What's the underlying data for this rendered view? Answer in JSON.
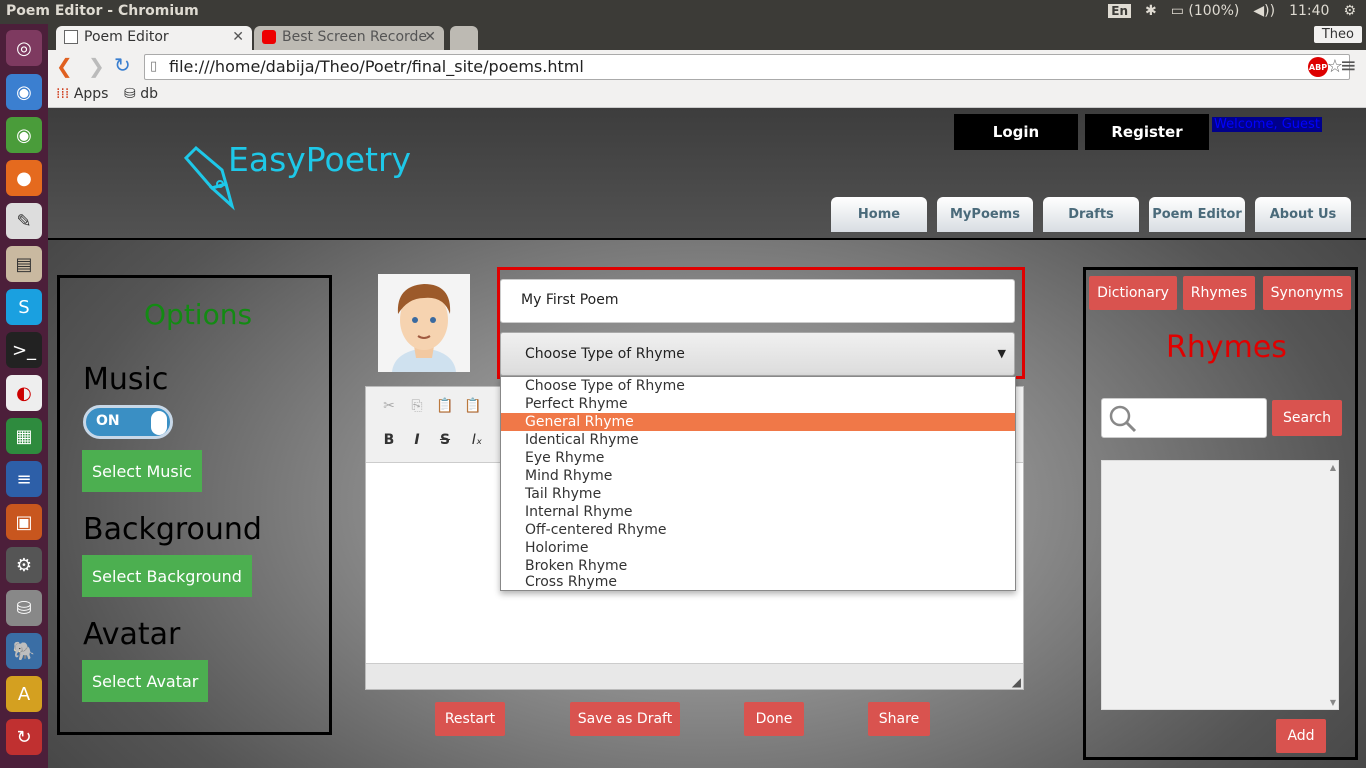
{
  "os": {
    "window_title": "Poem Editor - Chromium",
    "battery": "(100%)",
    "time": "11:40",
    "keyboard": "En",
    "launcher_items": [
      "ubuntu-dash",
      "chromium",
      "chrome",
      "firefox",
      "text-editor",
      "files",
      "skype",
      "terminal",
      "document-viewer",
      "spreadsheet",
      "writer",
      "impress",
      "system-settings",
      "database",
      "pgadmin",
      "app-store",
      "software-updater",
      "usb-drive"
    ]
  },
  "browser": {
    "tabs": [
      {
        "label": "Poem Editor",
        "active": true
      },
      {
        "label": "Best Screen Recorde",
        "active": false
      }
    ],
    "profile": "Theo",
    "url": "file:///home/dabija/Theo/Poetr/final_site/poems.html",
    "bookmarks": [
      {
        "label": "Apps"
      },
      {
        "label": "db"
      }
    ]
  },
  "site": {
    "logo": "EasyPoetry",
    "login_label": "Login",
    "register_label": "Register",
    "welcome": "Welcome, Guest",
    "nav": [
      {
        "label": "Home"
      },
      {
        "label": "MyPoems"
      },
      {
        "label": "Drafts"
      },
      {
        "label": "Poem Editor"
      },
      {
        "label": "About Us"
      }
    ]
  },
  "options": {
    "title": "Options",
    "music_heading": "Music",
    "toggle_state": "ON",
    "select_music": "Select Music",
    "background_heading": "Background",
    "select_background": "Select Background",
    "avatar_heading": "Avatar",
    "select_avatar": "Select Avatar"
  },
  "editor": {
    "title_value": "My First Poem",
    "rhyme_select_value": "Choose Type of Rhyme",
    "rhyme_options": [
      "Choose Type of Rhyme",
      "Perfect Rhyme",
      "General Rhyme",
      "Identical Rhyme",
      "Eye Rhyme",
      "Mind Rhyme",
      "Tail Rhyme",
      "Internal Rhyme",
      "Off-centered Rhyme",
      "Holorime",
      "Broken Rhyme",
      "Cross Rhyme"
    ],
    "highlighted_option": "General Rhyme",
    "actions": [
      {
        "label": "Restart"
      },
      {
        "label": "Save as Draft"
      },
      {
        "label": "Done"
      },
      {
        "label": "Share"
      }
    ]
  },
  "rhymes_panel": {
    "tabs": [
      {
        "label": "Dictionary"
      },
      {
        "label": "Rhymes"
      },
      {
        "label": "Synonyms"
      }
    ],
    "heading": "Rhymes",
    "search_value": "",
    "search_button": "Search",
    "add_button": "Add"
  },
  "colors": {
    "accent_green": "#4caf50",
    "accent_red": "#d9534f",
    "logo_cyan": "#1ec8e8",
    "highlight_orange": "#f07848",
    "launcher_purple": "#4c1f3a"
  }
}
